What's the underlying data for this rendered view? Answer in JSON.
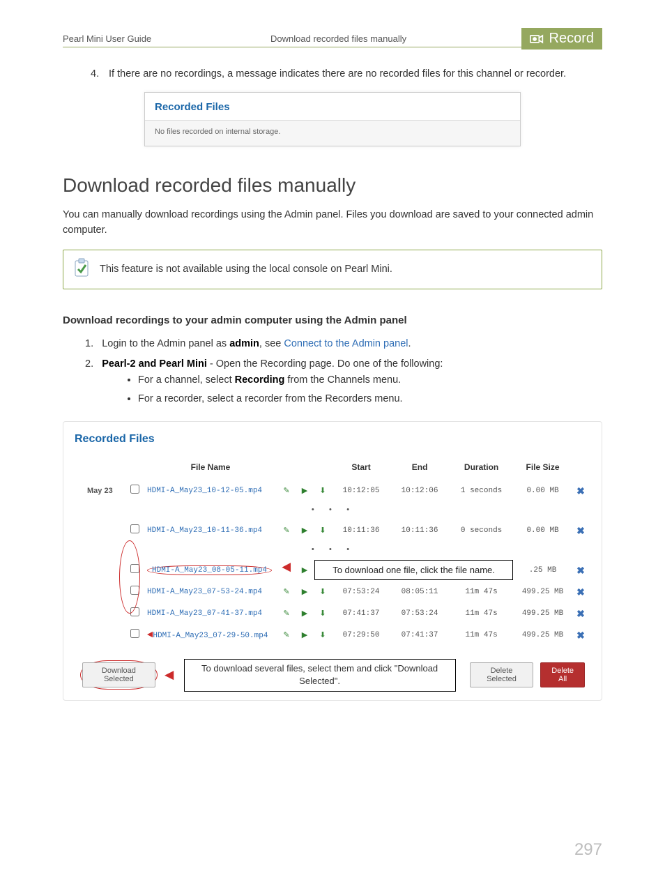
{
  "header": {
    "guide_title": "Pearl Mini User Guide",
    "section_short": "Download recorded files manually",
    "badge": "Record"
  },
  "step4": {
    "num": "4.",
    "text": "If there are no recordings, a message indicates there are no recorded files for this channel or recorder."
  },
  "shot1": {
    "title": "Recorded Files",
    "body": "No files recorded on internal storage."
  },
  "h1": "Download recorded files manually",
  "lead": "You can manually download recordings using the Admin panel. Files you download are saved to your connected admin computer.",
  "note": "This feature is not available using the local console on Pearl Mini.",
  "proc_heading": "Download recordings to your admin computer using the Admin panel",
  "steps": {
    "s1": {
      "num": "1.",
      "pre": "Login to the Admin panel as ",
      "bold": "admin",
      "mid": ", see ",
      "link": "Connect to the Admin panel",
      "post": "."
    },
    "s2": {
      "num": "2.",
      "bold": "Pearl-2 and Pearl Mini",
      "rest": " - Open the Recording page. Do one of the following:"
    },
    "s2a": "For a channel, select Recording from the Channels menu.",
    "s2a_bold": "Recording",
    "s2a_pre": "For a channel, select ",
    "s2a_post": " from the Channels menu.",
    "s2b": "For a recorder, select a recorder from the Recorders menu."
  },
  "shot2": {
    "title": "Recorded Files",
    "cols": {
      "fname": "File Name",
      "start": "Start",
      "end": "End",
      "duration": "Duration",
      "size": "File Size"
    },
    "date_label": "May 23",
    "rows": [
      {
        "file": "HDMI-A_May23_10-12-05.mp4",
        "start": "10:12:05",
        "end": "10:12:06",
        "dur": "1 seconds",
        "size": "0.00 MB"
      },
      {
        "file": "HDMI-A_May23_10-11-36.mp4",
        "start": "10:11:36",
        "end": "10:11:36",
        "dur": "0 seconds",
        "size": "0.00 MB"
      },
      {
        "file": "HDMI-A_May23_08-05-11.mp4",
        "start": "",
        "end": "",
        "dur": "",
        "size": ".25 MB"
      },
      {
        "file": "HDMI-A_May23_07-53-24.mp4",
        "start": "07:53:24",
        "end": "08:05:11",
        "dur": "11m 47s",
        "size": "499.25 MB"
      },
      {
        "file": "HDMI-A_May23_07-41-37.mp4",
        "start": "07:41:37",
        "end": "07:53:24",
        "dur": "11m 47s",
        "size": "499.25 MB"
      },
      {
        "file": "HDMI-A_May23_07-29-50.mp4",
        "start": "07:29:50",
        "end": "07:41:37",
        "dur": "11m 47s",
        "size": "499.25 MB"
      }
    ],
    "callout_single": "To download one file, click the file name.",
    "callout_multi": "To download several files, select them and click \"Download Selected\".",
    "btn_download_sel": "Download Selected",
    "btn_delete_sel": "Delete Selected",
    "btn_delete_all": "Delete All"
  },
  "page_number": "297"
}
